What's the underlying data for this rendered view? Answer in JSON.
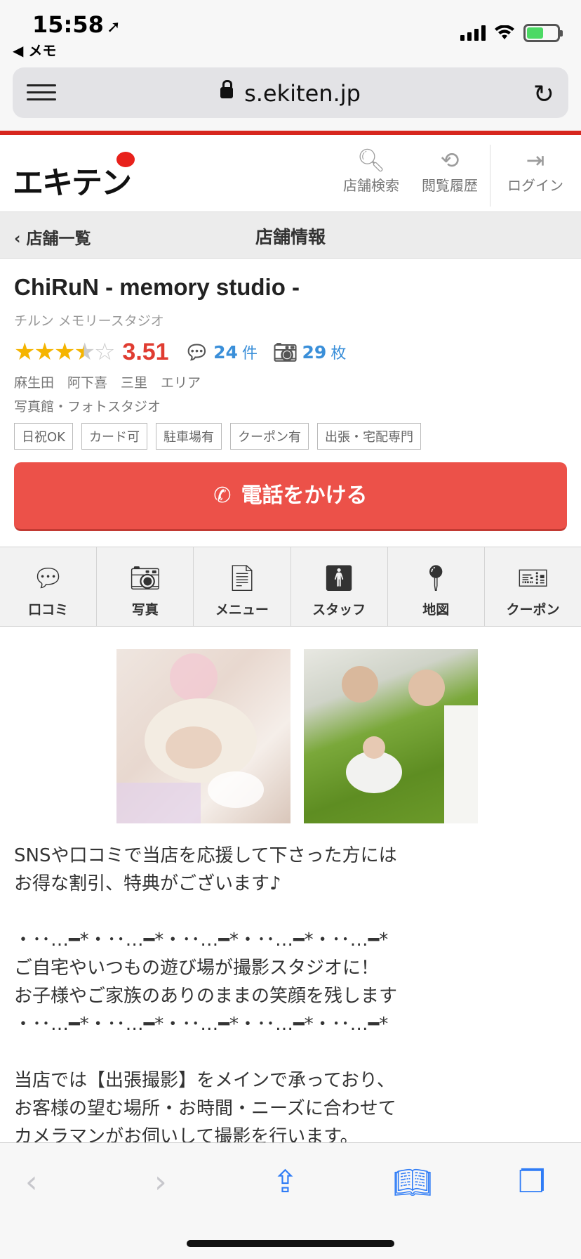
{
  "status": {
    "time": "15:58",
    "back_app": "◀ メモ"
  },
  "browser": {
    "url": "s.ekiten.jp"
  },
  "header": {
    "logo": "エキテン",
    "buttons": [
      {
        "label": "店舗検索",
        "icon": "search-icon"
      },
      {
        "label": "閲覧履歴",
        "icon": "history-icon"
      },
      {
        "label": "ログイン",
        "icon": "login-icon"
      }
    ]
  },
  "crumb": {
    "back": "店舗一覧",
    "title": "店舗情報"
  },
  "shop": {
    "name": "ChiRuN - memory studio -",
    "kana": "チルン メモリースタジオ",
    "score": "3.51",
    "reviews": "24",
    "reviews_unit": "件",
    "photos": "29",
    "photos_unit": "枚",
    "area": "麻生田　阿下喜　三里　エリア",
    "category": "写真館・フォトスタジオ",
    "tags": [
      "日祝OK",
      "カード可",
      "駐車場有",
      "クーポン有",
      "出張・宅配専門"
    ],
    "call_label": "電話をかける",
    "star_rating": 3.5
  },
  "tabs": [
    {
      "label": "口コミ",
      "icon": "comment-icon"
    },
    {
      "label": "写真",
      "icon": "camera-icon"
    },
    {
      "label": "メニュー",
      "icon": "document-icon"
    },
    {
      "label": "スタッフ",
      "icon": "person-icon"
    },
    {
      "label": "地図",
      "icon": "map-pin-icon"
    },
    {
      "label": "クーポン",
      "icon": "ticket-icon"
    }
  ],
  "description": "SNSや口コミで当店を応援して下さった方には\nお得な割引、特典がございます♪\n\n・･･…━*・･･…━*・･･…━*・･･…━*・･･…━*\nご自宅やいつもの遊び場が撮影スタジオに！\nお子様やご家族のありのままの笑顔を残します\n・･･…━*・･･…━*・･･…━*・･･…━*・･･…━*\n\n当店では【出張撮影】をメインで承っており、\nお客様の望む場所・お時間・ニーズに合わせて\nカメラマンがお伺いして撮影を行います。",
  "colors": {
    "brand_red": "#d7261e",
    "call_button": "#ec5149",
    "star": "#f5b400",
    "score": "#e03c31",
    "link_blue": "#3a8fd9"
  }
}
